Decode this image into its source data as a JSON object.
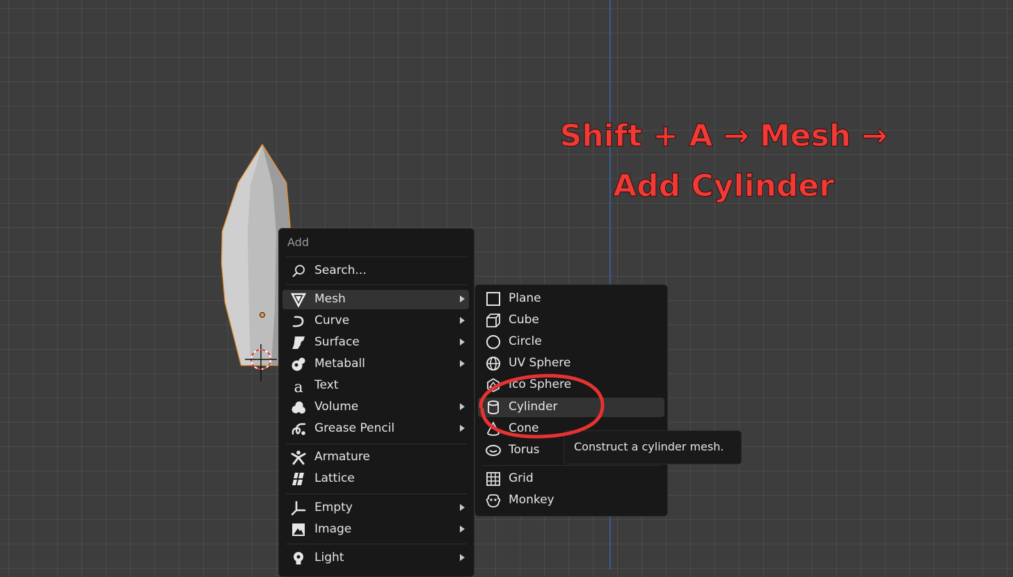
{
  "annotation": {
    "line1": "Shift + A → Mesh →",
    "line2": "Add Cylinder",
    "color": "#ef3a35"
  },
  "add_menu": {
    "title": "Add",
    "items": [
      {
        "label": "Search...",
        "icon": "search-icon",
        "submenu": false
      },
      {
        "label": "Mesh",
        "icon": "mesh-icon",
        "submenu": true,
        "highlighted": true
      },
      {
        "label": "Curve",
        "icon": "curve-icon",
        "submenu": true
      },
      {
        "label": "Surface",
        "icon": "surface-icon",
        "submenu": true
      },
      {
        "label": "Metaball",
        "icon": "metaball-icon",
        "submenu": true
      },
      {
        "label": "Text",
        "icon": "text-icon",
        "submenu": false
      },
      {
        "label": "Volume",
        "icon": "volume-icon",
        "submenu": true
      },
      {
        "label": "Grease Pencil",
        "icon": "grease-pencil-icon",
        "submenu": true
      },
      {
        "label": "Armature",
        "icon": "armature-icon",
        "submenu": false
      },
      {
        "label": "Lattice",
        "icon": "lattice-icon",
        "submenu": false
      },
      {
        "label": "Empty",
        "icon": "empty-icon",
        "submenu": true
      },
      {
        "label": "Image",
        "icon": "image-icon",
        "submenu": true
      },
      {
        "label": "Light",
        "icon": "light-icon",
        "submenu": true
      }
    ]
  },
  "mesh_submenu": {
    "items": [
      {
        "label": "Plane",
        "icon": "plane-icon"
      },
      {
        "label": "Cube",
        "icon": "cube-icon"
      },
      {
        "label": "Circle",
        "icon": "circle-icon"
      },
      {
        "label": "UV Sphere",
        "icon": "uv-sphere-icon"
      },
      {
        "label": "Ico Sphere",
        "icon": "ico-sphere-icon"
      },
      {
        "label": "Cylinder",
        "icon": "cylinder-icon",
        "highlighted": true
      },
      {
        "label": "Cone",
        "icon": "cone-icon"
      },
      {
        "label": "Torus",
        "icon": "torus-icon"
      },
      {
        "label": "Grid",
        "icon": "grid-icon"
      },
      {
        "label": "Monkey",
        "icon": "monkey-icon"
      }
    ]
  },
  "tooltip": {
    "text": "Construct a cylinder mesh."
  },
  "colors": {
    "viewport_bg": "#3d3d3d",
    "menu_bg": "#181818",
    "selection_outline": "#f0942c",
    "z_axis": "#3b5c94"
  }
}
